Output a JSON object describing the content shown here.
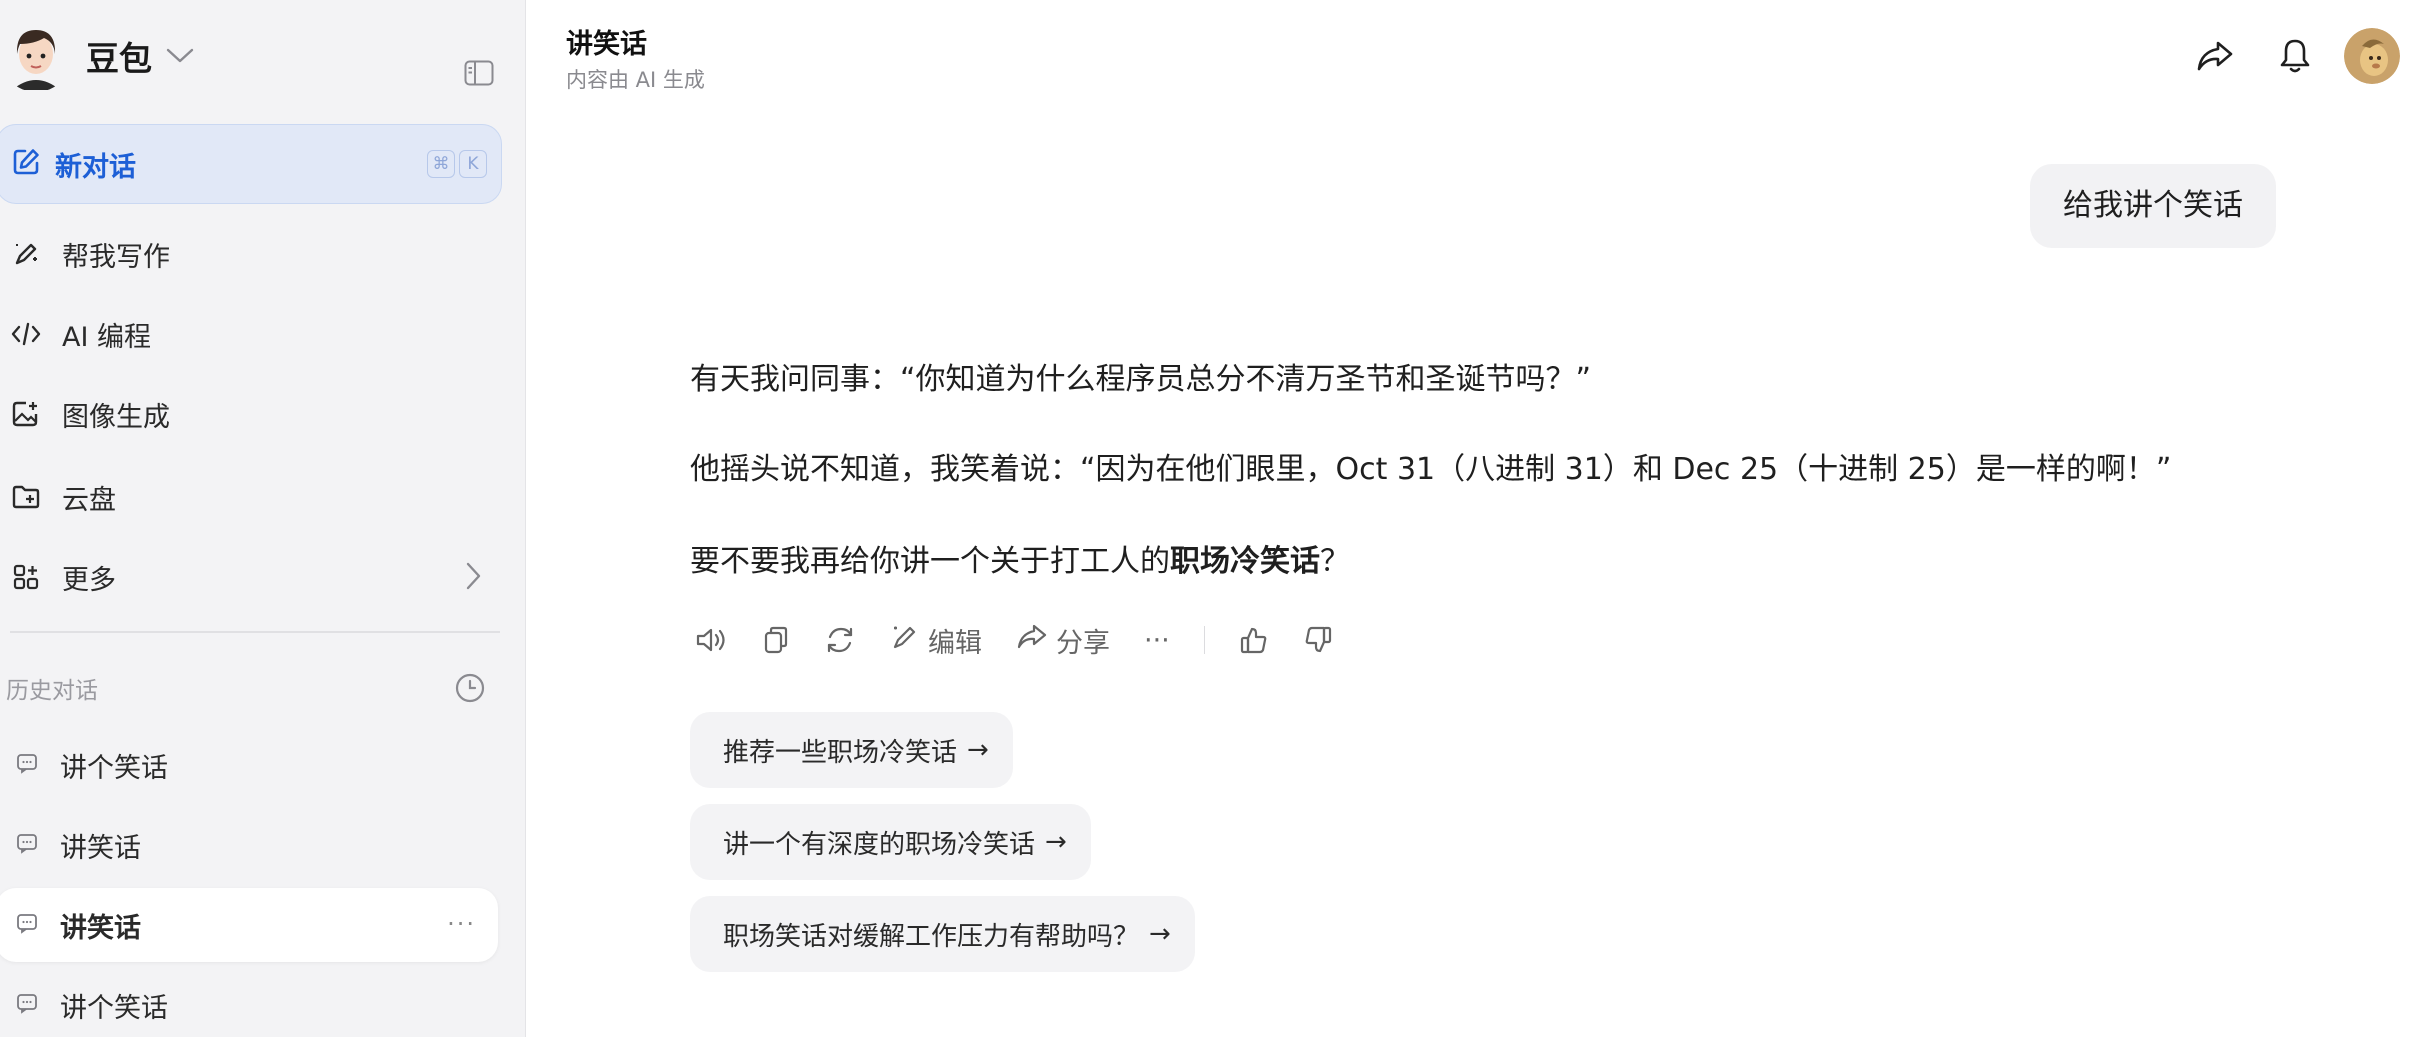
{
  "sidebar": {
    "brand_name": "豆包",
    "new_chat": {
      "label": "新对话",
      "shortcut": [
        "⌘",
        "K"
      ]
    },
    "nav": [
      {
        "label": "帮我写作",
        "icon": "pen-sparkle-icon"
      },
      {
        "label": "AI 编程",
        "icon": "code-icon"
      },
      {
        "label": "图像生成",
        "icon": "image-add-icon"
      },
      {
        "label": "云盘",
        "icon": "folder-add-icon"
      },
      {
        "label": "更多",
        "icon": "apps-plus-icon"
      }
    ],
    "history_title": "历史对话",
    "history": [
      {
        "label": "讲个笑话"
      },
      {
        "label": "讲笑话"
      },
      {
        "label": "讲笑话",
        "active": true,
        "more": "···"
      },
      {
        "label": "讲个笑话"
      }
    ]
  },
  "header": {
    "title": "讲笑话",
    "subtitle": "内容由 AI 生成"
  },
  "conversation": {
    "user_message": "给我讲个笑话",
    "answer": {
      "p1": "有天我问同事：“你知道为什么程序员总分不清万圣节和圣诞节吗？”",
      "p2": "他摇头说不知道，我笑着说：“因为在他们眼里，Oct 31（八进制 31）和 Dec 25（十进制 25）是一样的啊！”",
      "p3_prefix": "要不要我再给你讲一个关于打工人的",
      "p3_bold": "职场冷笑话",
      "p3_suffix": "？"
    },
    "actions": {
      "edit": "编辑",
      "share": "分享",
      "more": "···"
    },
    "suggestions": [
      {
        "label": "推荐一些职场冷笑话",
        "arrow": "→"
      },
      {
        "label": "讲一个有深度的职场冷笑话",
        "arrow": "→"
      },
      {
        "label": "职场笑话对缓解工作压力有帮助吗？",
        "arrow": "→"
      }
    ]
  },
  "colors": {
    "accent": "#1d5fd6",
    "sidebar_bg": "#f3f3f5",
    "new_chat_bg": "#e1e8f7"
  }
}
